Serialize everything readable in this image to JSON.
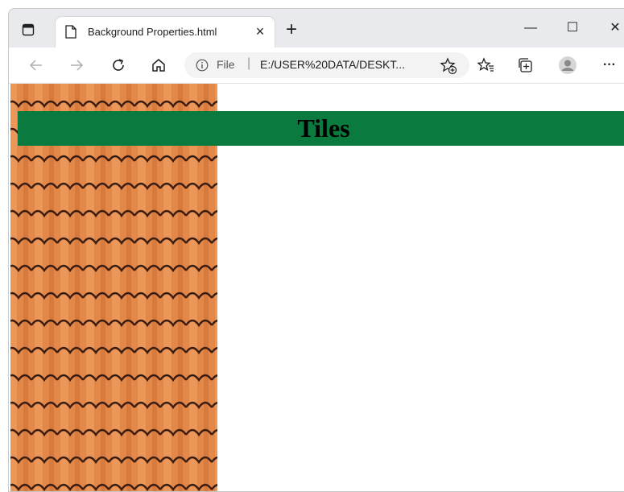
{
  "browser": {
    "tab": {
      "title": "Background Properties.html",
      "close_icon": "×"
    },
    "new_tab_icon": "+",
    "window_controls": {
      "minimize": "—",
      "maximize": "☐",
      "close": "✕"
    },
    "address": {
      "scheme_label": "File",
      "separator": "|",
      "url": "E:/USER%20DATA/DESKT..."
    },
    "toolbar_icons": [
      "back-arrow-icon",
      "forward-arrow-icon",
      "refresh-icon",
      "home-icon",
      "favorites-icon",
      "collections-icon",
      "profile-icon",
      "more-icon"
    ],
    "overflow_label": "···"
  },
  "page": {
    "heading": "Tiles",
    "heading_bg": "#0b7a3e",
    "tile_color": "#e58a4a",
    "tile_outline": "#3a1d10"
  }
}
